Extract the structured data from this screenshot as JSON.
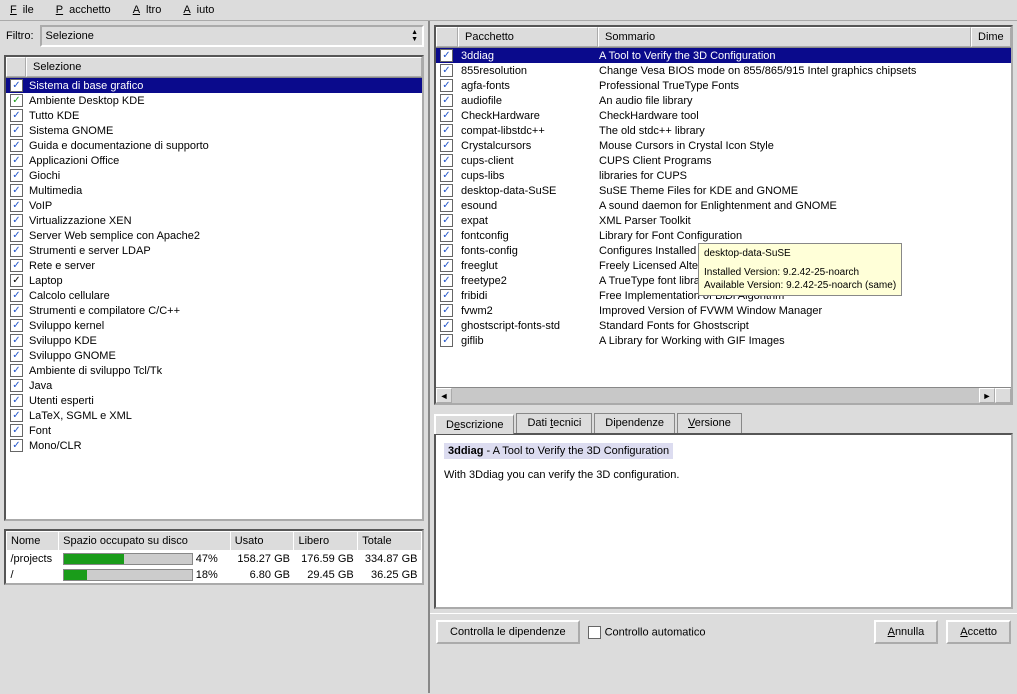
{
  "menubar": [
    "File",
    "Pacchetto",
    "Altro",
    "Aiuto"
  ],
  "menubar_accel": [
    "F",
    "P",
    "A",
    "A"
  ],
  "filter": {
    "label": "Filtro:",
    "value": "Selezione"
  },
  "selection_header": "Selezione",
  "selections": [
    {
      "label": "Sistema di base grafico",
      "checked": true,
      "selected": true
    },
    {
      "label": "Ambiente Desktop KDE",
      "checked": true,
      "green": true
    },
    {
      "label": "Tutto KDE",
      "checked": true
    },
    {
      "label": "Sistema GNOME",
      "checked": true
    },
    {
      "label": "Guida e documentazione di supporto",
      "checked": true
    },
    {
      "label": "Applicazioni Office",
      "checked": true
    },
    {
      "label": "Giochi",
      "checked": true
    },
    {
      "label": "Multimedia",
      "checked": true
    },
    {
      "label": "VoIP",
      "checked": true
    },
    {
      "label": "Virtualizzazione XEN",
      "checked": true
    },
    {
      "label": "Server Web semplice con Apache2",
      "checked": true
    },
    {
      "label": "Strumenti e server LDAP",
      "checked": true
    },
    {
      "label": "Rete e server",
      "checked": true
    },
    {
      "label": "Laptop",
      "checked": true,
      "black": true
    },
    {
      "label": "Calcolo cellulare",
      "checked": true
    },
    {
      "label": "Strumenti e compilatore C/C++",
      "checked": true
    },
    {
      "label": "Sviluppo kernel",
      "checked": true
    },
    {
      "label": "Sviluppo KDE",
      "checked": true
    },
    {
      "label": "Sviluppo GNOME",
      "checked": true
    },
    {
      "label": "Ambiente di sviluppo Tcl/Tk",
      "checked": true
    },
    {
      "label": "Java",
      "checked": true
    },
    {
      "label": "Utenti esperti",
      "checked": true
    },
    {
      "label": "LaTeX, SGML e XML",
      "checked": true
    },
    {
      "label": "Font",
      "checked": true
    },
    {
      "label": "Mono/CLR",
      "checked": true
    }
  ],
  "disk": {
    "headers": [
      "Nome",
      "Spazio occupato su disco",
      "Usato",
      "Libero",
      "Totale"
    ],
    "rows": [
      {
        "name": "/projects",
        "pct": 47,
        "used": "158.27 GB",
        "free": "176.59 GB",
        "total": "334.87 GB"
      },
      {
        "name": "/",
        "pct": 18,
        "used": "6.80 GB",
        "free": "29.45 GB",
        "total": "36.25 GB"
      }
    ]
  },
  "pkg_headers": [
    "",
    "Pacchetto",
    "Sommario",
    "Dime"
  ],
  "packages": [
    {
      "name": "3ddiag",
      "summary": "A Tool to Verify the 3D Configuration",
      "selected": true
    },
    {
      "name": "855resolution",
      "summary": "Change Vesa BIOS mode on 855/865/915 Intel graphics chipsets"
    },
    {
      "name": "agfa-fonts",
      "summary": "Professional TrueType Fonts"
    },
    {
      "name": "audiofile",
      "summary": "An audio file library"
    },
    {
      "name": "CheckHardware",
      "summary": "CheckHardware tool"
    },
    {
      "name": "compat-libstdc++",
      "summary": "The old stdc++ library"
    },
    {
      "name": "Crystalcursors",
      "summary": "Mouse Cursors in Crystal Icon Style"
    },
    {
      "name": "cups-client",
      "summary": "CUPS Client Programs"
    },
    {
      "name": "cups-libs",
      "summary": "libraries for CUPS"
    },
    {
      "name": "desktop-data-SuSE",
      "summary": "SuSE Theme Files for KDE and GNOME"
    },
    {
      "name": "esound",
      "summary": "A sound daemon for Enlightenment and GNOME"
    },
    {
      "name": "expat",
      "summary": "XML Parser Toolkit"
    },
    {
      "name": "fontconfig",
      "summary": "Library for Font Configuration"
    },
    {
      "name": "fonts-config",
      "summary": "Configures Installed X Window System Fonts"
    },
    {
      "name": "freeglut",
      "summary": "Freely Licensed Alternative to the GLUT Library"
    },
    {
      "name": "freetype2",
      "summary": "A TrueType font library"
    },
    {
      "name": "fribidi",
      "summary": "Free Implementation of BiDi Algorithm"
    },
    {
      "name": "fvwm2",
      "summary": "Improved Version of FVWM Window Manager"
    },
    {
      "name": "ghostscript-fonts-std",
      "summary": "Standard Fonts for Ghostscript"
    },
    {
      "name": "giflib",
      "summary": "A Library for Working with GIF Images"
    }
  ],
  "tooltip": {
    "title": "desktop-data-SuSE",
    "l1": "Installed Version: 9.2.42-25-noarch",
    "l2": "Available Version: 9.2.42-25-noarch (same)"
  },
  "tabs": [
    "Descrizione",
    "Dati tecnici",
    "Dipendenze",
    "Versione"
  ],
  "tabs_accel": [
    "e",
    "t",
    "",
    "V"
  ],
  "desc": {
    "name": "3ddiag",
    "sep": " - ",
    "summary": "A Tool to Verify the 3D Configuration",
    "body": "With 3Ddiag you can verify the 3D configuration."
  },
  "bottom": {
    "check_deps": "Controlla le dipendenze",
    "auto": "Controllo automatico",
    "cancel": "Annulla",
    "accept": "Accetto"
  }
}
